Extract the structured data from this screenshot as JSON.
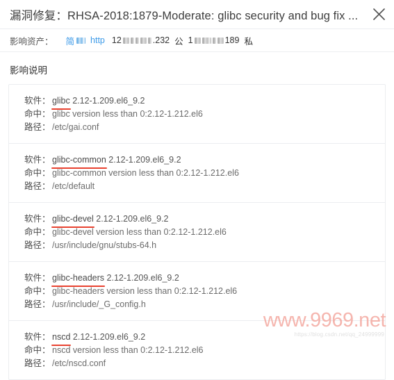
{
  "window": {
    "title": "漏洞修复：RHSA-2018:1879-Moderate: glibc security and bug fix ...",
    "close_icon": "close-icon"
  },
  "assets": {
    "label": "影响资产：",
    "link_simple": "简",
    "link_protocol": "http",
    "ip_prefix": "12",
    "ip_suffix": ".232",
    "public_tag": "公",
    "count_prefix": "1",
    "count_value": "189",
    "private_tag": "私"
  },
  "section": {
    "title": "影响说明",
    "labels": {
      "software": "软件：",
      "hit": "命中：",
      "path": "路径："
    },
    "entries": [
      {
        "package": "glibc",
        "version": "2.12-1.209.el6_9.2",
        "hit": "glibc version less than 0:2.12-1.212.el6",
        "path": "/etc/gai.conf"
      },
      {
        "package": "glibc-common",
        "version": "2.12-1.209.el6_9.2",
        "hit": "glibc-common version less than 0:2.12-1.212.el6",
        "path": "/etc/default"
      },
      {
        "package": "glibc-devel",
        "version": "2.12-1.209.el6_9.2",
        "hit": "glibc-devel version less than 0:2.12-1.212.el6",
        "path": "/usr/include/gnu/stubs-64.h"
      },
      {
        "package": "glibc-headers",
        "version": "2.12-1.209.el6_9.2",
        "hit": "glibc-headers version less than 0:2.12-1.212.el6",
        "path": "/usr/include/_G_config.h"
      },
      {
        "package": "nscd",
        "version": "2.12-1.209.el6_9.2",
        "hit": "nscd version less than 0:2.12-1.212.el6",
        "path": "/etc/nscd.conf"
      }
    ]
  },
  "watermark": {
    "primary": "www.9969.net",
    "secondary": "https://blog.csdn.net/qq_24999999"
  },
  "colors": {
    "link": "#3c9ae8",
    "annotation": "#e8412f",
    "watermark": "#f4a9a0",
    "border": "#ebedf0"
  }
}
